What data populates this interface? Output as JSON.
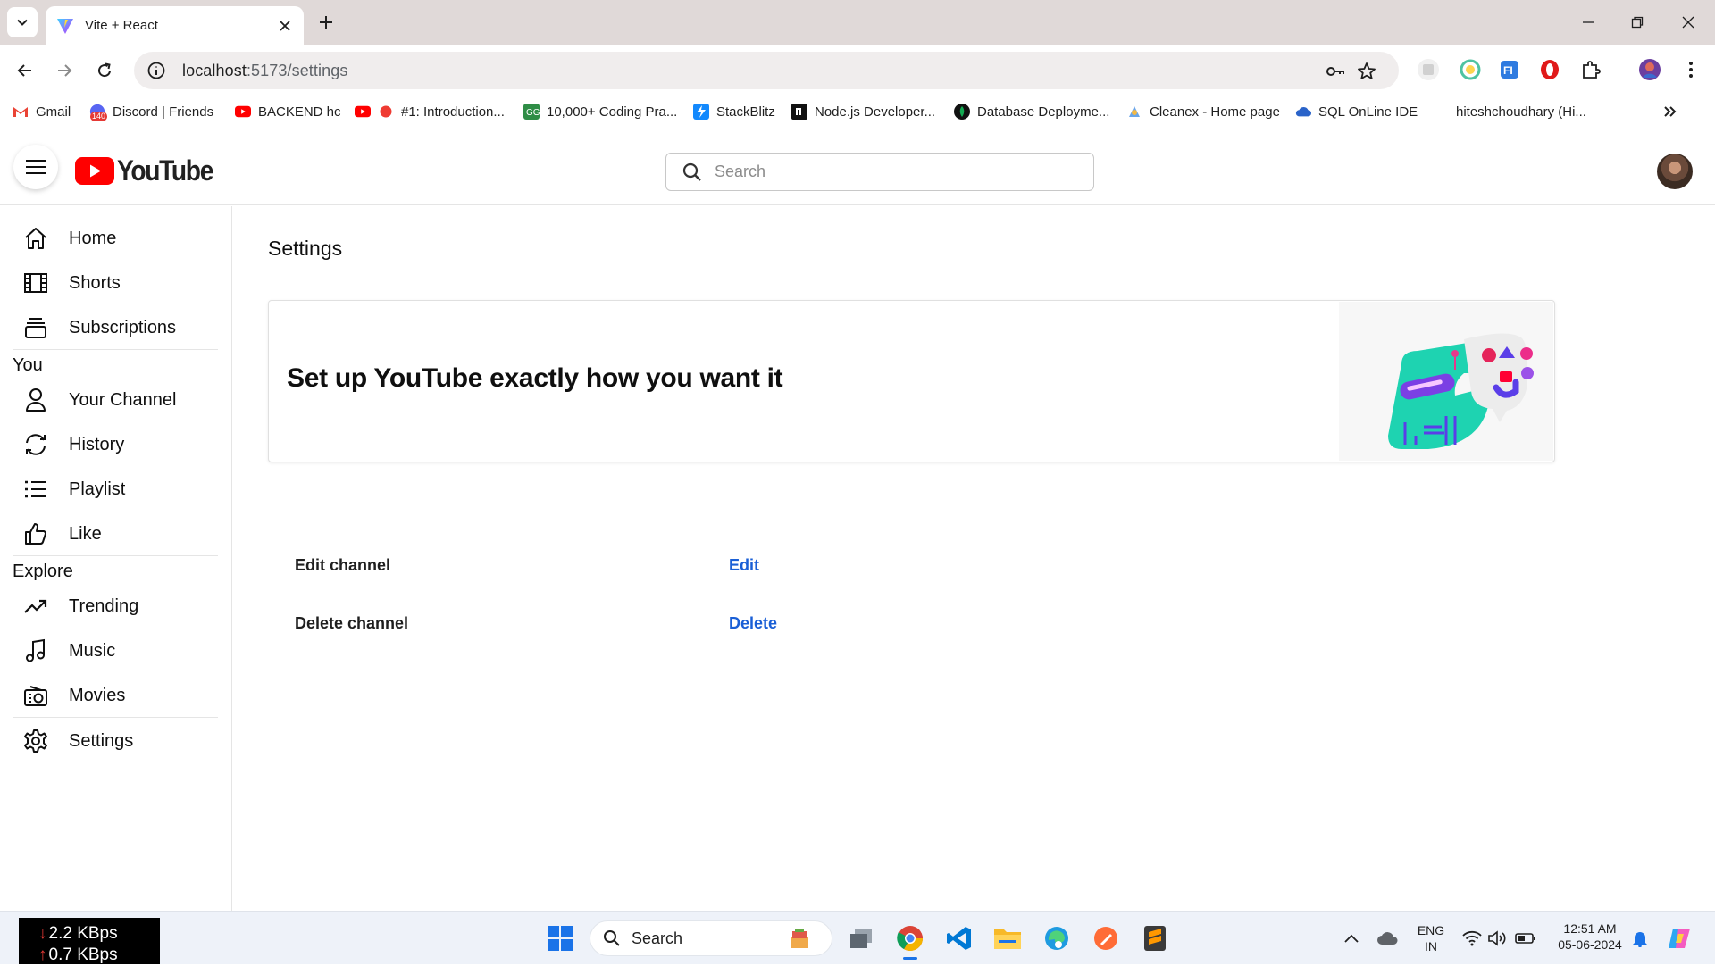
{
  "browser": {
    "tab_title": "Vite + React",
    "url_host": "localhost",
    "url_path": ":5173/settings",
    "bookmarks": [
      {
        "label": "Gmail"
      },
      {
        "label": "Discord | Friends"
      },
      {
        "label": "BACKEND hc"
      },
      {
        "label": "#1: Introduction..."
      },
      {
        "label": "10,000+ Coding Pra..."
      },
      {
        "label": "StackBlitz"
      },
      {
        "label": "Node.js Developer..."
      },
      {
        "label": "Database Deployme..."
      },
      {
        "label": "Cleanex - Home page"
      },
      {
        "label": "SQL OnLine IDE"
      },
      {
        "label": "hiteshchoudhary (Hi..."
      }
    ],
    "discord_badge": "140"
  },
  "header": {
    "logo_text": "YouTube",
    "search_placeholder": "Search"
  },
  "sidebar": {
    "main": [
      {
        "label": "Home",
        "icon": "home-icon"
      },
      {
        "label": "Shorts",
        "icon": "film-icon"
      },
      {
        "label": "Subscriptions",
        "icon": "subscriptions-icon"
      }
    ],
    "you_title": "You",
    "you": [
      {
        "label": "Your Channel",
        "icon": "user-icon"
      },
      {
        "label": "History",
        "icon": "history-icon"
      },
      {
        "label": "Playlist",
        "icon": "list-icon"
      },
      {
        "label": "Like",
        "icon": "thumbs-up-icon"
      }
    ],
    "explore_title": "Explore",
    "explore": [
      {
        "label": "Trending",
        "icon": "trending-icon"
      },
      {
        "label": "Music",
        "icon": "music-icon"
      },
      {
        "label": "Movies",
        "icon": "movies-icon"
      }
    ],
    "settings": {
      "label": "Settings",
      "icon": "gear-icon"
    }
  },
  "main": {
    "page_title": "Settings",
    "banner_headline": "Set up YouTube exactly how you want it",
    "rows": [
      {
        "label": "Edit channel",
        "action": "Edit"
      },
      {
        "label": "Delete channel",
        "action": "Delete"
      }
    ]
  },
  "taskbar": {
    "net_down": "2.2 KBps",
    "net_up": "0.7 KBps",
    "search_label": "Search",
    "lang_1": "ENG",
    "lang_2": "IN",
    "time": "12:51 AM",
    "date": "05-06-2024"
  },
  "colors": {
    "accent_link": "#1a5fd6",
    "youtube_red": "#ff0000"
  }
}
